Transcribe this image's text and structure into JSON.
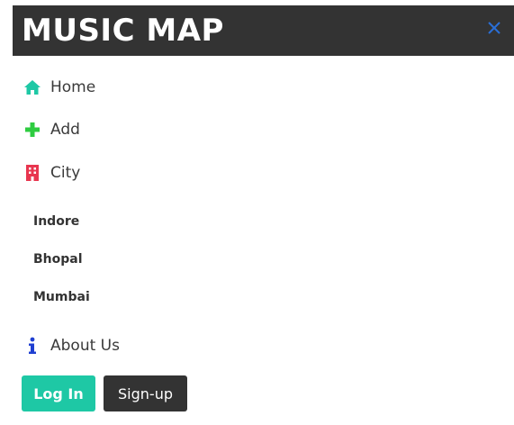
{
  "brand": {
    "title": "MUSIC MAP"
  },
  "nav": {
    "items": [
      {
        "label": "Home",
        "icon": "home-icon"
      },
      {
        "label": "Add",
        "icon": "plus-icon"
      },
      {
        "label": "City",
        "icon": "building-icon"
      },
      {
        "label": "About Us",
        "icon": "info-icon"
      }
    ],
    "cities": [
      "Indore",
      "Bhopal",
      "Mumbai"
    ]
  },
  "actions": {
    "login_label": "Log In",
    "signup_label": "Sign-up"
  },
  "colors": {
    "topbar": "#333333",
    "accent": "#1ec8a5",
    "close": "#2a6fd6",
    "add_icon": "#2ecc40",
    "city_icon": "#e8364f",
    "info_icon": "#1f3fd1"
  }
}
